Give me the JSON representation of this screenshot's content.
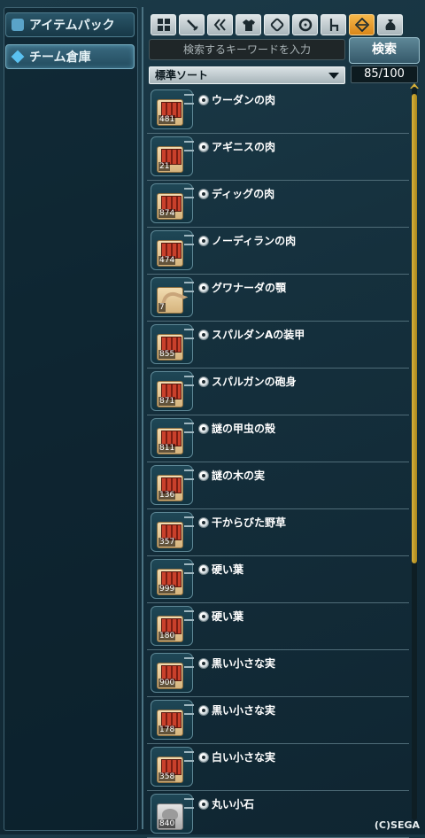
{
  "left": {
    "buttons": [
      {
        "label": "アイテムパック",
        "icon": "pack-icon"
      },
      {
        "label": "チーム倉庫",
        "icon": "diamond-icon"
      }
    ]
  },
  "tabs": [
    {
      "icon": "grid-icon"
    },
    {
      "icon": "sword-icon"
    },
    {
      "icon": "double-chevron-icon"
    },
    {
      "icon": "shirt-icon"
    },
    {
      "icon": "tag-icon"
    },
    {
      "icon": "disc-icon"
    },
    {
      "icon": "chair-icon"
    },
    {
      "icon": "diamond-arrows-icon",
      "active": true
    },
    {
      "icon": "bag-icon"
    }
  ],
  "search": {
    "placeholder": "検索するキーワードを入力",
    "button": "検索"
  },
  "sort": {
    "selected": "標準ソート"
  },
  "capacity": "85/100",
  "items": [
    {
      "name": "ウーダンの肉",
      "qty": "481",
      "kind": "material"
    },
    {
      "name": "アギニスの肉",
      "qty": "21",
      "kind": "material"
    },
    {
      "name": "ディッグの肉",
      "qty": "874",
      "kind": "material"
    },
    {
      "name": "ノーディランの肉",
      "qty": "474",
      "kind": "material"
    },
    {
      "name": "グワナーダの顎",
      "qty": "7",
      "kind": "horn"
    },
    {
      "name": "スパルダンAの装甲",
      "qty": "855",
      "kind": "material"
    },
    {
      "name": "スパルガンの砲身",
      "qty": "871",
      "kind": "material"
    },
    {
      "name": "謎の甲虫の殻",
      "qty": "811",
      "kind": "material"
    },
    {
      "name": "謎の木の実",
      "qty": "136",
      "kind": "material"
    },
    {
      "name": "干からびた野草",
      "qty": "357",
      "kind": "material"
    },
    {
      "name": "硬い葉",
      "qty": "999",
      "kind": "material"
    },
    {
      "name": "硬い葉",
      "qty": "180",
      "kind": "material"
    },
    {
      "name": "黒い小さな実",
      "qty": "900",
      "kind": "material"
    },
    {
      "name": "黒い小さな実",
      "qty": "178",
      "kind": "material"
    },
    {
      "name": "白い小さな実",
      "qty": "358",
      "kind": "material"
    },
    {
      "name": "丸い小石",
      "qty": "840",
      "kind": "stone"
    }
  ],
  "copyright": "(C)SEGA"
}
